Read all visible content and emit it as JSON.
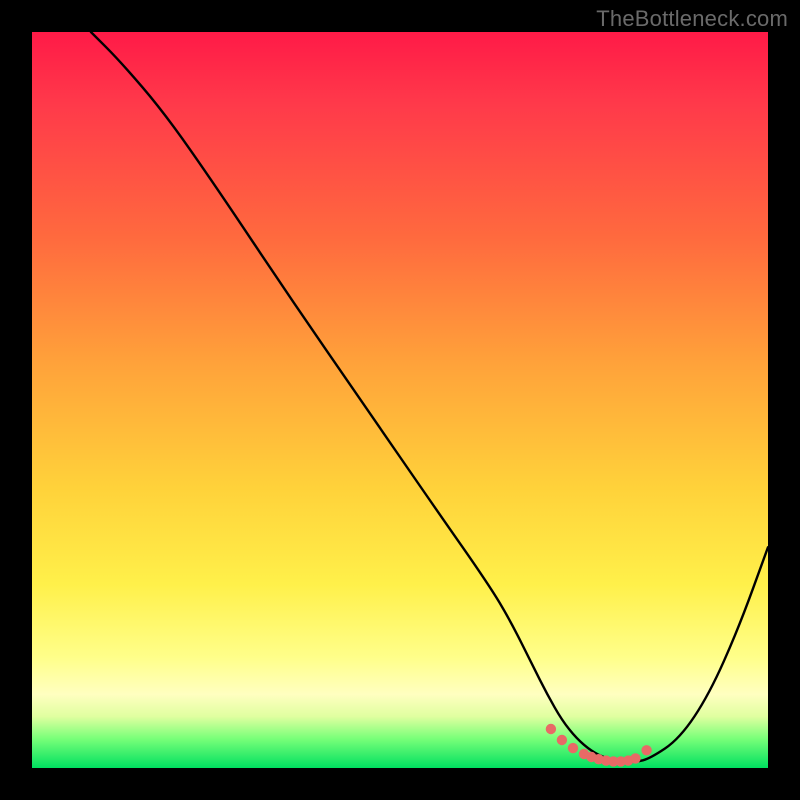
{
  "watermark": "TheBottleneck.com",
  "colors": {
    "frame": "#000000",
    "curve": "#000000",
    "marker": "#e86a66",
    "grad_top": "#ff1a47",
    "grad_bottom": "#00e060"
  },
  "chart_data": {
    "type": "line",
    "title": "",
    "xlabel": "",
    "ylabel": "",
    "xlim": [
      0,
      100
    ],
    "ylim": [
      0,
      100
    ],
    "series": [
      {
        "name": "curve",
        "x": [
          8,
          12,
          18,
          25,
          35,
          45,
          55,
          62,
          65,
          68,
          70,
          72,
          74,
          76,
          78,
          80,
          82,
          84,
          88,
          92,
          96,
          100
        ],
        "y": [
          100,
          96,
          89,
          79,
          64,
          49.5,
          35,
          25,
          20,
          14,
          10,
          6.5,
          4,
          2.3,
          1.3,
          0.8,
          0.8,
          1.3,
          4,
          10,
          19,
          30
        ]
      }
    ],
    "markers": {
      "name": "trough-markers",
      "x": [
        70.5,
        72,
        73.5,
        75,
        76,
        77,
        78,
        79,
        80,
        81,
        82,
        83.5
      ],
      "y": [
        5.3,
        3.8,
        2.7,
        1.9,
        1.5,
        1.2,
        1.0,
        0.9,
        0.9,
        1.0,
        1.3,
        2.4
      ]
    }
  }
}
